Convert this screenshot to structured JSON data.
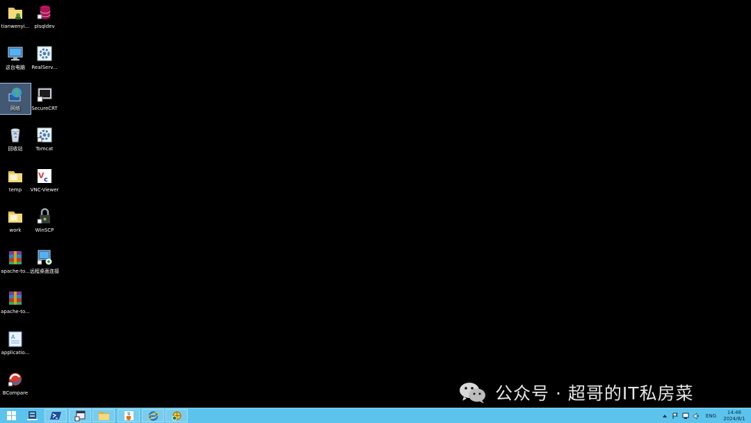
{
  "desktop": {
    "icons": [
      {
        "label": "tianwenyi...",
        "icon": "folder-user-icon"
      },
      {
        "label": "plsqldev",
        "icon": "database-icon"
      },
      {
        "label": "这台电脑",
        "icon": "computer-icon"
      },
      {
        "label": "RealServ...",
        "icon": "service-gear-icon"
      },
      {
        "label": "网络",
        "icon": "network-globe-icon"
      },
      {
        "label": "SecureCRT",
        "icon": "securecrt-terminal-icon"
      },
      {
        "label": "回收站",
        "icon": "recycle-bin-icon"
      },
      {
        "label": "Tomcat",
        "icon": "service-gear-icon"
      },
      {
        "label": "temp",
        "icon": "folder-icon"
      },
      {
        "label": "VNC-Viewer",
        "icon": "vnc-icon"
      },
      {
        "label": "work",
        "icon": "folder-icon"
      },
      {
        "label": "WinSCP",
        "icon": "winscp-lock-icon"
      },
      {
        "label": "apache-to...",
        "icon": "winrar-archive-icon"
      },
      {
        "label": "远程桌面连接",
        "icon": "remote-desktop-icon"
      },
      {
        "label": "apache-to...",
        "icon": "winrar-archive-icon"
      },
      {
        "label": "applicatio...",
        "icon": "text-document-icon"
      },
      {
        "label": "BCompare",
        "icon": "bcompare-icon"
      }
    ]
  },
  "watermark": {
    "text": "公众号 · 超哥的IT私房菜"
  },
  "taskbar": {
    "buttons": [
      {
        "name": "start-button",
        "icon": "windows-logo-icon"
      },
      {
        "name": "server-manager-button",
        "icon": "server-manager-icon"
      },
      {
        "name": "powershell-button",
        "icon": "powershell-icon"
      },
      {
        "name": "explorer-task-button",
        "icon": "explorer-window-icon"
      },
      {
        "name": "file-explorer-button",
        "icon": "folder-icon"
      },
      {
        "name": "java-button",
        "icon": "java-cup-icon"
      },
      {
        "name": "internet-explorer-button",
        "icon": "internet-explorer-icon"
      },
      {
        "name": "globe-app-button",
        "icon": "globe-app-icon"
      }
    ],
    "tray": {
      "icons": [
        "chevron-up-icon",
        "flag-icon",
        "network-icon",
        "volume-icon"
      ],
      "language": "ENG",
      "time": "14:46",
      "date": "2024/8/1"
    }
  },
  "colors": {
    "taskbar": "#5bc3ec",
    "desktop": "#000000",
    "selection": "#7aa0d2"
  }
}
